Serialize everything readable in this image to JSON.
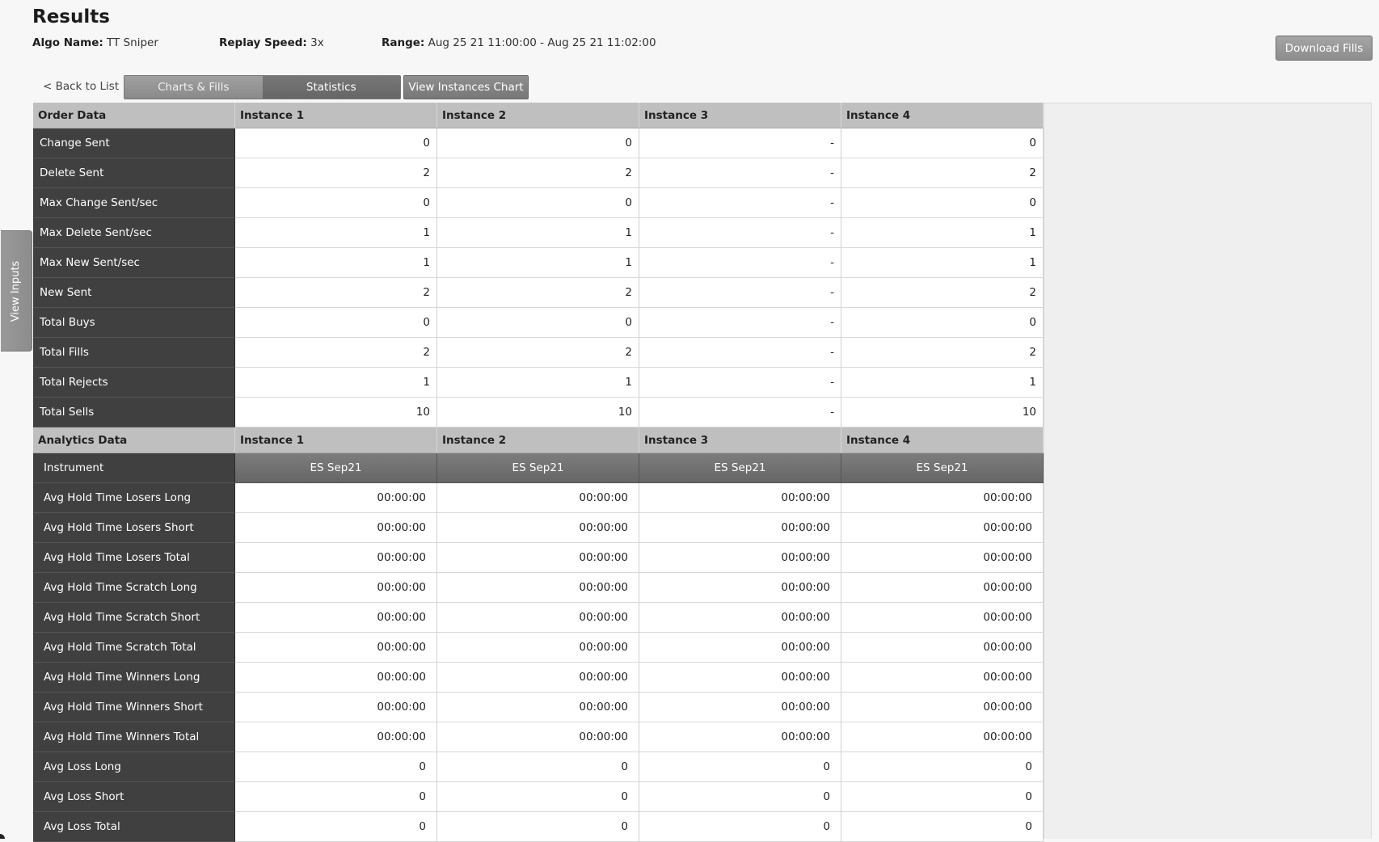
{
  "header": {
    "title": "Results",
    "algo_label": "Algo Name:",
    "algo_value": "TT Sniper",
    "speed_label": "Replay Speed:",
    "speed_value": "3x",
    "range_label": "Range:",
    "range_value": "Aug 25 21 11:00:00 - Aug 25 21 11:02:00",
    "download_label": "Download Fills"
  },
  "nav": {
    "back_label": "< Back to List",
    "tabs": [
      {
        "label": "Charts & Fills",
        "active": false
      },
      {
        "label": "Statistics",
        "active": true
      }
    ],
    "view_chart_label": "View Instances Chart",
    "side_tab_label": "View Inputs"
  },
  "order_data": {
    "header": [
      "Order Data",
      "Instance 1",
      "Instance 2",
      "Instance 3",
      "Instance 4"
    ],
    "rows": [
      {
        "label": "Change Sent",
        "values": [
          "0",
          "0",
          "-",
          "0"
        ]
      },
      {
        "label": "Delete Sent",
        "values": [
          "2",
          "2",
          "-",
          "2"
        ]
      },
      {
        "label": "Max Change Sent/sec",
        "values": [
          "0",
          "0",
          "-",
          "0"
        ]
      },
      {
        "label": "Max Delete Sent/sec",
        "values": [
          "1",
          "1",
          "-",
          "1"
        ]
      },
      {
        "label": "Max New Sent/sec",
        "values": [
          "1",
          "1",
          "-",
          "1"
        ]
      },
      {
        "label": "New Sent",
        "values": [
          "2",
          "2",
          "-",
          "2"
        ]
      },
      {
        "label": "Total Buys",
        "values": [
          "0",
          "0",
          "-",
          "0"
        ]
      },
      {
        "label": "Total Fills",
        "values": [
          "2",
          "2",
          "-",
          "2"
        ]
      },
      {
        "label": "Total Rejects",
        "values": [
          "1",
          "1",
          "-",
          "1"
        ]
      },
      {
        "label": "Total Sells",
        "values": [
          "10",
          "10",
          "-",
          "10"
        ]
      }
    ]
  },
  "analytics_data": {
    "header": [
      "Analytics Data",
      "Instance 1",
      "Instance 2",
      "Instance 3",
      "Instance 4"
    ],
    "instrument_row": {
      "label": "Instrument",
      "values": [
        "ES Sep21",
        "ES Sep21",
        "ES Sep21",
        "ES Sep21"
      ]
    },
    "rows": [
      {
        "label": "Avg Hold Time Losers Long",
        "values": [
          "00:00:00",
          "00:00:00",
          "00:00:00",
          "00:00:00"
        ]
      },
      {
        "label": "Avg Hold Time Losers Short",
        "values": [
          "00:00:00",
          "00:00:00",
          "00:00:00",
          "00:00:00"
        ]
      },
      {
        "label": "Avg Hold Time Losers Total",
        "values": [
          "00:00:00",
          "00:00:00",
          "00:00:00",
          "00:00:00"
        ]
      },
      {
        "label": "Avg Hold Time Scratch Long",
        "values": [
          "00:00:00",
          "00:00:00",
          "00:00:00",
          "00:00:00"
        ]
      },
      {
        "label": "Avg Hold Time Scratch Short",
        "values": [
          "00:00:00",
          "00:00:00",
          "00:00:00",
          "00:00:00"
        ]
      },
      {
        "label": "Avg Hold Time Scratch Total",
        "values": [
          "00:00:00",
          "00:00:00",
          "00:00:00",
          "00:00:00"
        ]
      },
      {
        "label": "Avg Hold Time Winners Long",
        "values": [
          "00:00:00",
          "00:00:00",
          "00:00:00",
          "00:00:00"
        ]
      },
      {
        "label": "Avg Hold Time Winners Short",
        "values": [
          "00:00:00",
          "00:00:00",
          "00:00:00",
          "00:00:00"
        ]
      },
      {
        "label": "Avg Hold Time Winners Total",
        "values": [
          "00:00:00",
          "00:00:00",
          "00:00:00",
          "00:00:00"
        ]
      },
      {
        "label": "Avg Loss Long",
        "values": [
          "0",
          "0",
          "0",
          "0"
        ]
      },
      {
        "label": "Avg Loss Short",
        "values": [
          "0",
          "0",
          "0",
          "0"
        ]
      },
      {
        "label": "Avg Loss Total",
        "values": [
          "0",
          "0",
          "0",
          "0"
        ]
      }
    ]
  }
}
